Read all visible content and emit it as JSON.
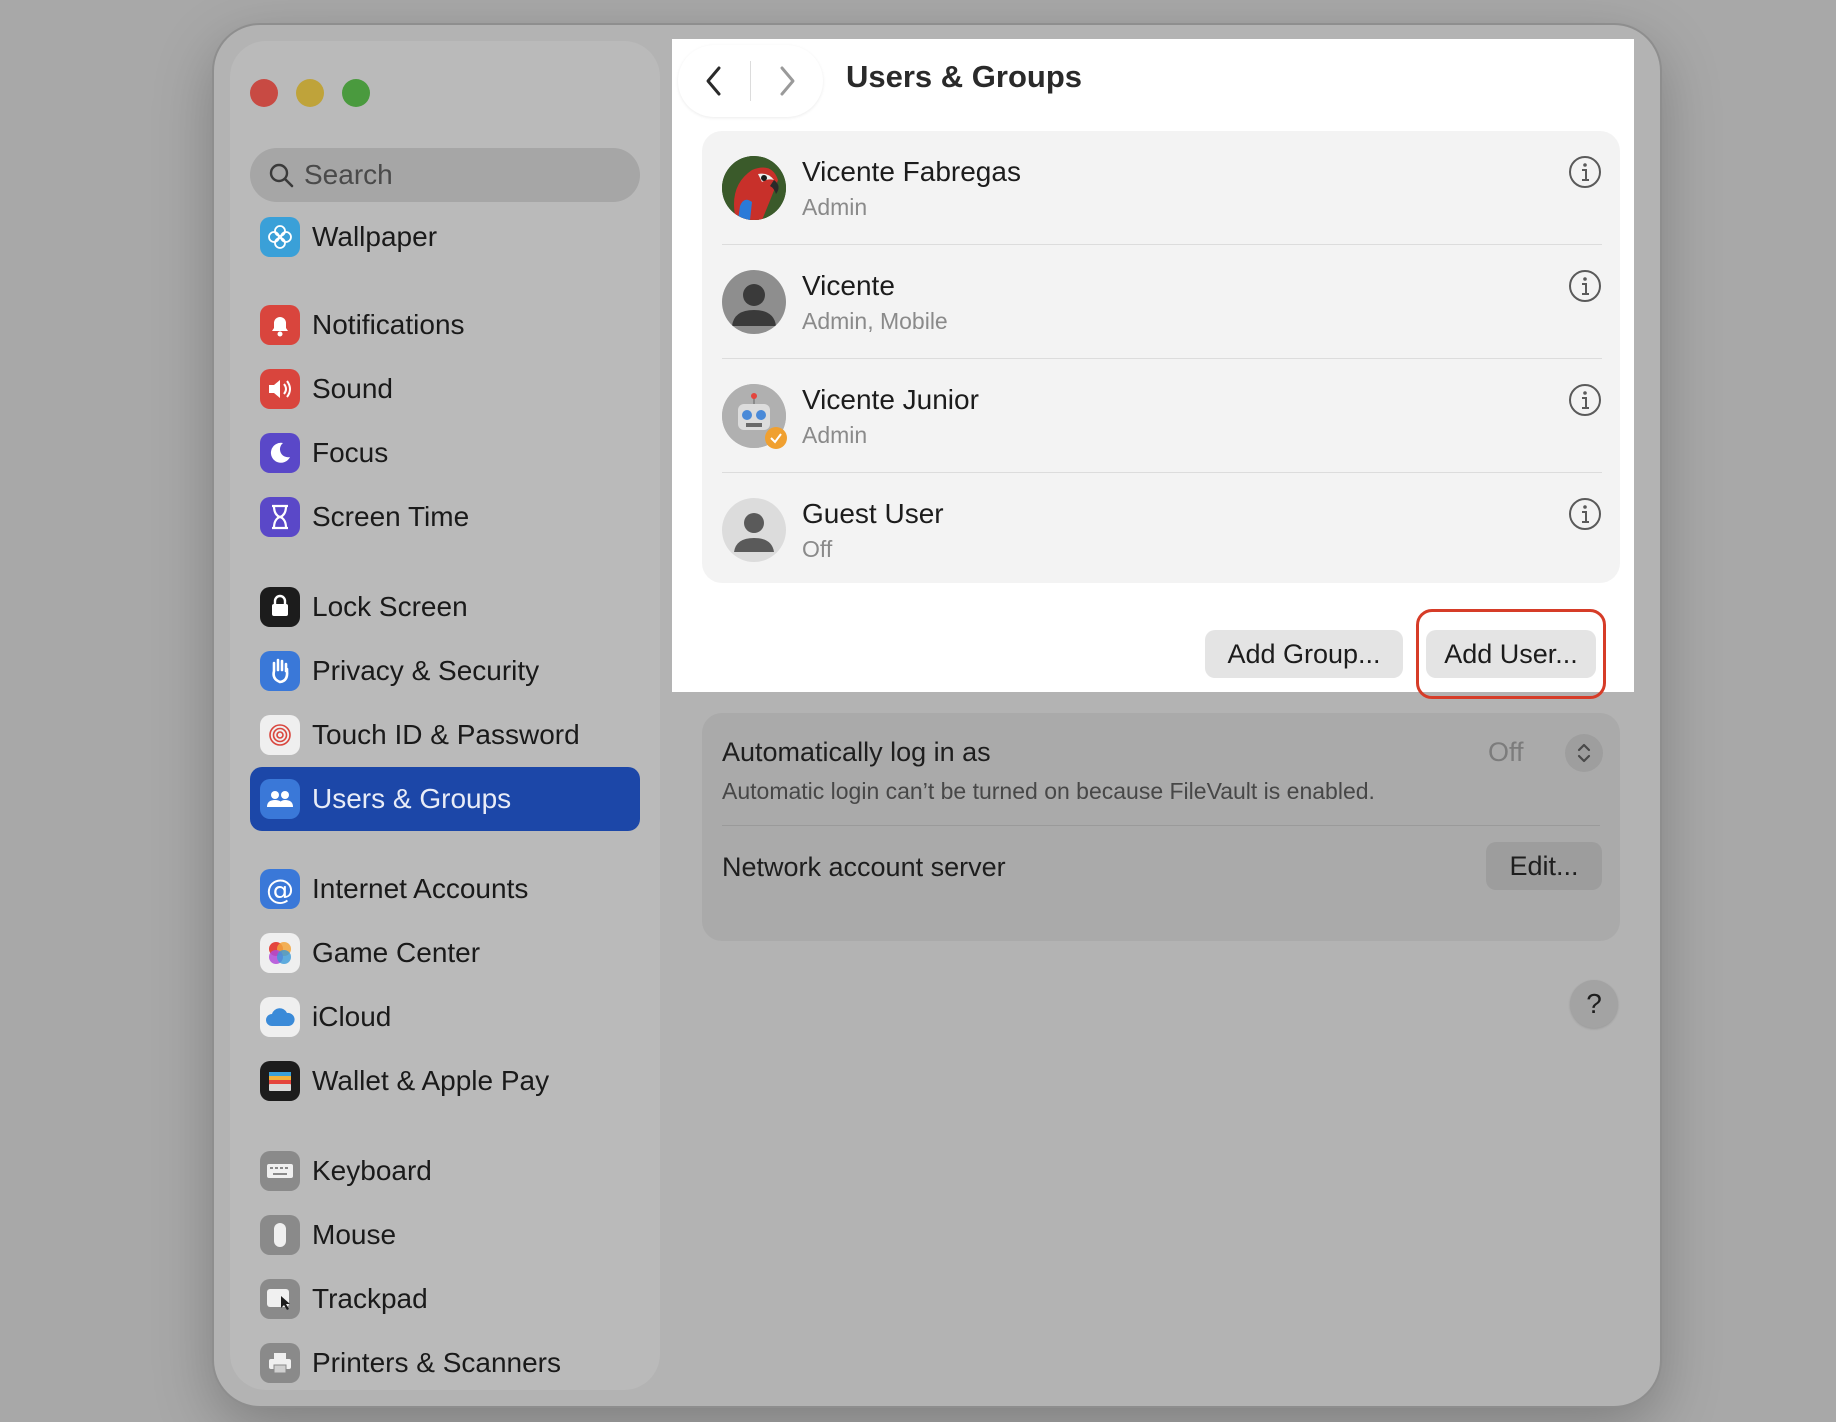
{
  "window": {
    "title": "Users & Groups"
  },
  "sidebar": {
    "search_placeholder": "Search",
    "items": [
      {
        "label": "Wallpaper",
        "icon": "wallpaper-icon",
        "color": "#3aa0d8"
      },
      {
        "label": "Notifications",
        "icon": "notifications-icon",
        "color": "#d9453d"
      },
      {
        "label": "Sound",
        "icon": "sound-icon",
        "color": "#d9453d"
      },
      {
        "label": "Focus",
        "icon": "focus-icon",
        "color": "#5a48c8"
      },
      {
        "label": "Screen Time",
        "icon": "screen-time-icon",
        "color": "#5a48c8"
      },
      {
        "label": "Lock Screen",
        "icon": "lock-screen-icon",
        "color": "#1c1c1c"
      },
      {
        "label": "Privacy & Security",
        "icon": "privacy-hand-icon",
        "color": "#3a78d8"
      },
      {
        "label": "Touch ID & Password",
        "icon": "fingerprint-icon",
        "color": "#f2f2f2"
      },
      {
        "label": "Users & Groups",
        "icon": "users-icon",
        "color": "#3a78d8",
        "active": true
      },
      {
        "label": "Internet Accounts",
        "icon": "at-sign-icon",
        "color": "#3a78d8"
      },
      {
        "label": "Game Center",
        "icon": "game-center-icon",
        "color": "#f2f2f2"
      },
      {
        "label": "iCloud",
        "icon": "icloud-icon",
        "color": "#f2f2f2"
      },
      {
        "label": "Wallet & Apple Pay",
        "icon": "wallet-icon",
        "color": "#1c1c1c"
      },
      {
        "label": "Keyboard",
        "icon": "keyboard-icon",
        "color": "#8a8a8a"
      },
      {
        "label": "Mouse",
        "icon": "mouse-icon",
        "color": "#8a8a8a"
      },
      {
        "label": "Trackpad",
        "icon": "trackpad-icon",
        "color": "#8a8a8a"
      },
      {
        "label": "Printers & Scanners",
        "icon": "printer-icon",
        "color": "#8a8a8a"
      }
    ]
  },
  "users": [
    {
      "name": "Vicente Fabregas",
      "role": "Admin",
      "avatar": "parrot-avatar"
    },
    {
      "name": "Vicente",
      "role": "Admin, Mobile",
      "avatar": "person-avatar"
    },
    {
      "name": "Vicente Junior",
      "role": "Admin",
      "avatar": "robot-avatar"
    },
    {
      "name": "Guest User",
      "role": "Off",
      "avatar": "guest-avatar"
    }
  ],
  "buttons": {
    "add_group": "Add Group...",
    "add_user": "Add User...",
    "edit": "Edit...",
    "help": "?"
  },
  "login": {
    "label": "Automatically log in as",
    "value": "Off",
    "note": "Automatic login can’t be turned on because FileVault is enabled."
  },
  "network": {
    "label": "Network account server"
  },
  "colors": {
    "accent": "#1c47a8",
    "highlight": "#d63c28"
  }
}
